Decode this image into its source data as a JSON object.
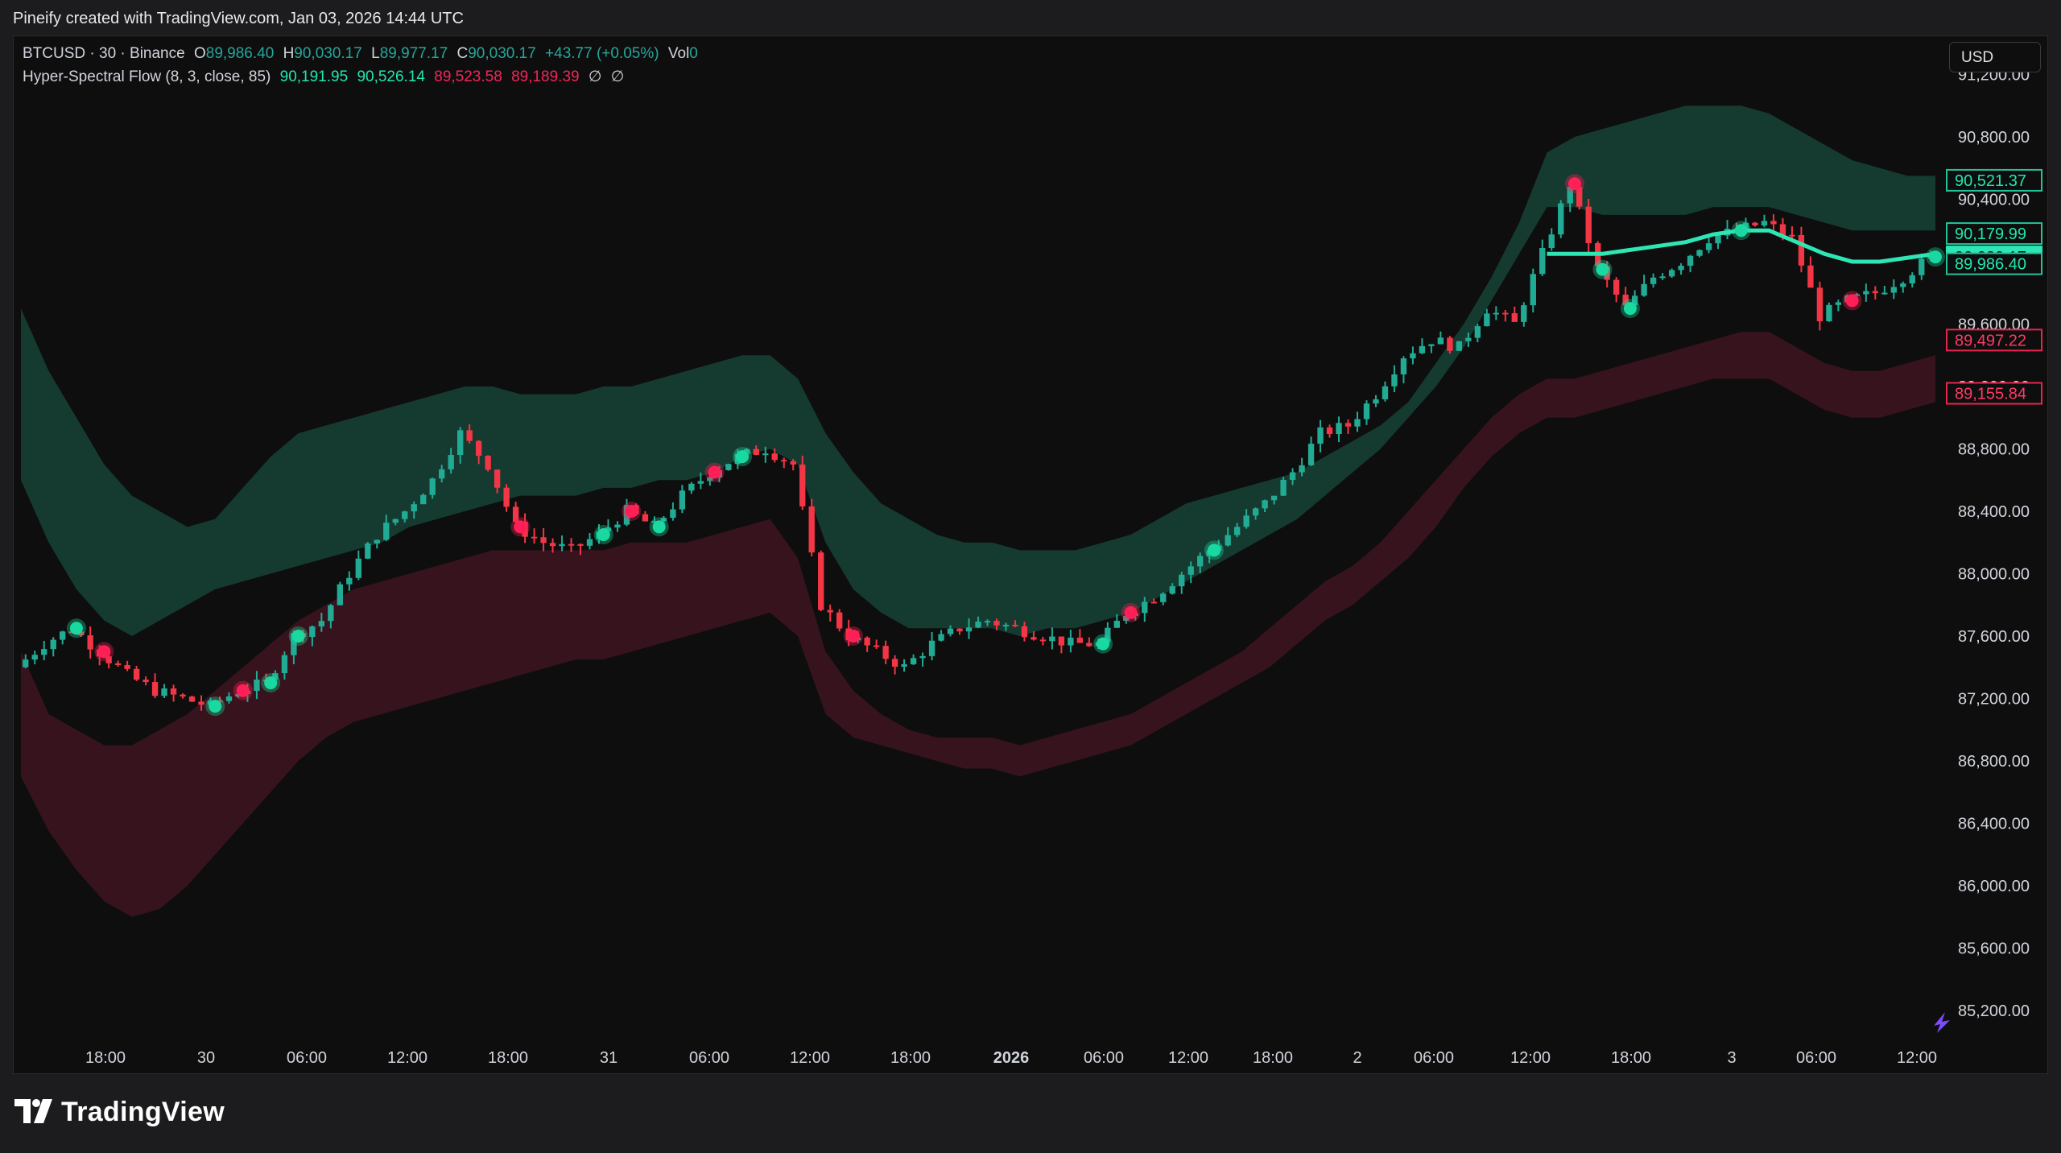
{
  "header": {
    "credit": "Pineify created with TradingView.com, Jan 03, 2026 14:44 UTC"
  },
  "legend": {
    "symbol": "BTCUSD · 30 · Binance",
    "o_label": "O",
    "o_value": "89,986.40",
    "h_label": "H",
    "h_value": "90,030.17",
    "l_label": "L",
    "l_value": "89,977.17",
    "c_label": "C",
    "c_value": "90,030.17",
    "change": "+43.77 (+0.05%)",
    "vol_label": "Vol",
    "vol_value": "0",
    "indicator": "Hyper-Spectral Flow (8, 3, close, 85)",
    "ind_v1": "90,191.95",
    "ind_v2": "90,526.14",
    "ind_v3": "89,523.58",
    "ind_v4": "89,189.39",
    "ind_na1": "∅",
    "ind_na2": "∅"
  },
  "currency_button": "USD",
  "colors": {
    "up": "#22ab94",
    "down": "#f23645",
    "teal_line": "#2ee6b4",
    "upper_band": "#163d33",
    "lower_band": "#3a141f",
    "background": "#0e0e0e"
  },
  "chart_data": {
    "type": "candlestick",
    "title": "BTCUSD · 30 · Binance",
    "x_ticks": [
      "18:00",
      "30",
      "06:00",
      "12:00",
      "18:00",
      "31",
      "06:00",
      "12:00",
      "18:00",
      "2026",
      "06:00",
      "12:00",
      "18:00",
      "2",
      "06:00",
      "12:00",
      "18:00",
      "3",
      "06:00",
      "12:00"
    ],
    "y_ticks": [
      "91,200.00",
      "90,800.00",
      "90,400.00",
      "90,000.00",
      "89,600.00",
      "89,200.00",
      "88,800.00",
      "88,400.00",
      "88,000.00",
      "87,600.00",
      "87,200.00",
      "86,800.00",
      "86,400.00",
      "86,000.00",
      "85,600.00",
      "85,200.00"
    ],
    "ylim": [
      85050,
      91450
    ],
    "price_labels": [
      {
        "text": "90,521.37",
        "value": 90521.37,
        "kind": "upper-band"
      },
      {
        "text": "90,179.99",
        "value": 90179.99,
        "kind": "mid-line"
      },
      {
        "text": "90,030.17",
        "value": 90030.17,
        "kind": "last-price"
      },
      {
        "text": "89,986.40",
        "value": 89986.4,
        "kind": "open"
      },
      {
        "text": "89,497.22",
        "value": 89497.22,
        "kind": "lower-band"
      },
      {
        "text": "89,155.84",
        "value": 89155.84,
        "kind": "lower-band-2"
      }
    ],
    "close_path": [
      87400,
      87550,
      87650,
      87500,
      87350,
      87250,
      87200,
      87150,
      87250,
      87300,
      87600,
      87700,
      88000,
      88250,
      88400,
      88600,
      88900,
      88700,
      88300,
      88200,
      88150,
      88250,
      88400,
      88300,
      88500,
      88650,
      88750,
      88800,
      88700,
      87800,
      87600,
      87500,
      87400,
      87550,
      87650,
      87700,
      87650,
      87600,
      87550,
      87550,
      87750,
      87850,
      88000,
      88150,
      88300,
      88450,
      88650,
      88900,
      88950,
      89150,
      89400,
      89500,
      89450,
      89700,
      89600,
      90050,
      90500,
      89950,
      89700,
      89900,
      90000,
      90150,
      90200,
      90250,
      90150,
      89650,
      89750,
      89800,
      89900,
      90030
    ],
    "upper_band": [
      89700,
      89300,
      89000,
      88700,
      88500,
      88400,
      88300,
      88350,
      88550,
      88750,
      88900,
      88950,
      89000,
      89050,
      89100,
      89150,
      89200,
      89200,
      89150,
      89150,
      89150,
      89200,
      89200,
      89250,
      89300,
      89350,
      89400,
      89400,
      89250,
      88900,
      88650,
      88450,
      88350,
      88250,
      88200,
      88200,
      88150,
      88150,
      88150,
      88200,
      88250,
      88350,
      88450,
      88500,
      88550,
      88600,
      88650,
      88750,
      88850,
      88950,
      89100,
      89350,
      89600,
      89900,
      90250,
      90700,
      90800,
      90850,
      90900,
      90950,
      91000,
      91000,
      91000,
      90950,
      90850,
      90750,
      90650,
      90600,
      90550,
      90550
    ],
    "mid_upper": [
      88600,
      88200,
      87900,
      87700,
      87600,
      87700,
      87800,
      87900,
      87950,
      88000,
      88050,
      88100,
      88150,
      88200,
      88300,
      88350,
      88400,
      88450,
      88500,
      88500,
      88500,
      88550,
      88550,
      88600,
      88600,
      88650,
      88750,
      88800,
      88700,
      88200,
      87900,
      87750,
      87650,
      87650,
      87650,
      87650,
      87600,
      87650,
      87650,
      87700,
      87750,
      87850,
      87950,
      88050,
      88150,
      88250,
      88350,
      88500,
      88650,
      88800,
      89000,
      89200,
      89450,
      89750,
      90050,
      90350,
      90350,
      90300,
      90300,
      90300,
      90300,
      90350,
      90350,
      90350,
      90300,
      90250,
      90200,
      90200,
      90200,
      90200
    ],
    "mid_lower": [
      87500,
      87100,
      87000,
      86900,
      86900,
      87000,
      87100,
      87250,
      87400,
      87550,
      87700,
      87800,
      87900,
      87950,
      88000,
      88050,
      88100,
      88150,
      88150,
      88150,
      88150,
      88150,
      88200,
      88200,
      88200,
      88250,
      88300,
      88350,
      88100,
      87500,
      87250,
      87100,
      87000,
      86950,
      86950,
      86950,
      86900,
      86950,
      87000,
      87050,
      87100,
      87200,
      87300,
      87400,
      87500,
      87650,
      87800,
      87950,
      88050,
      88200,
      88400,
      88600,
      88800,
      89000,
      89150,
      89250,
      89250,
      89300,
      89350,
      89400,
      89450,
      89500,
      89550,
      89550,
      89450,
      89350,
      89300,
      89300,
      89350,
      89400
    ],
    "lower_band": [
      86700,
      86350,
      86100,
      85900,
      85800,
      85850,
      86000,
      86200,
      86400,
      86600,
      86800,
      86950,
      87050,
      87100,
      87150,
      87200,
      87250,
      87300,
      87350,
      87400,
      87450,
      87450,
      87500,
      87550,
      87600,
      87650,
      87700,
      87750,
      87600,
      87100,
      86950,
      86900,
      86850,
      86800,
      86750,
      86750,
      86700,
      86750,
      86800,
      86850,
      86900,
      87000,
      87100,
      87200,
      87300,
      87400,
      87550,
      87700,
      87800,
      87950,
      88100,
      88300,
      88550,
      88750,
      88900,
      89000,
      89000,
      89050,
      89100,
      89150,
      89200,
      89250,
      89250,
      89250,
      89150,
      89050,
      89000,
      89000,
      89050,
      89100
    ],
    "signals": [
      {
        "i": 2,
        "type": "buy"
      },
      {
        "i": 3,
        "type": "sell"
      },
      {
        "i": 7,
        "type": "buy"
      },
      {
        "i": 8,
        "type": "sell"
      },
      {
        "i": 9,
        "type": "buy"
      },
      {
        "i": 10,
        "type": "buy"
      },
      {
        "i": 18,
        "type": "sell"
      },
      {
        "i": 21,
        "type": "buy"
      },
      {
        "i": 22,
        "type": "sell"
      },
      {
        "i": 23,
        "type": "buy"
      },
      {
        "i": 25,
        "type": "sell"
      },
      {
        "i": 26,
        "type": "buy"
      },
      {
        "i": 30,
        "type": "sell"
      },
      {
        "i": 39,
        "type": "buy"
      },
      {
        "i": 40,
        "type": "sell"
      },
      {
        "i": 43,
        "type": "buy"
      },
      {
        "i": 56,
        "type": "sell"
      },
      {
        "i": 57,
        "type": "buy"
      },
      {
        "i": 58,
        "type": "buy"
      },
      {
        "i": 62,
        "type": "buy"
      },
      {
        "i": 66,
        "type": "sell"
      },
      {
        "i": 69,
        "type": "buy"
      }
    ]
  }
}
